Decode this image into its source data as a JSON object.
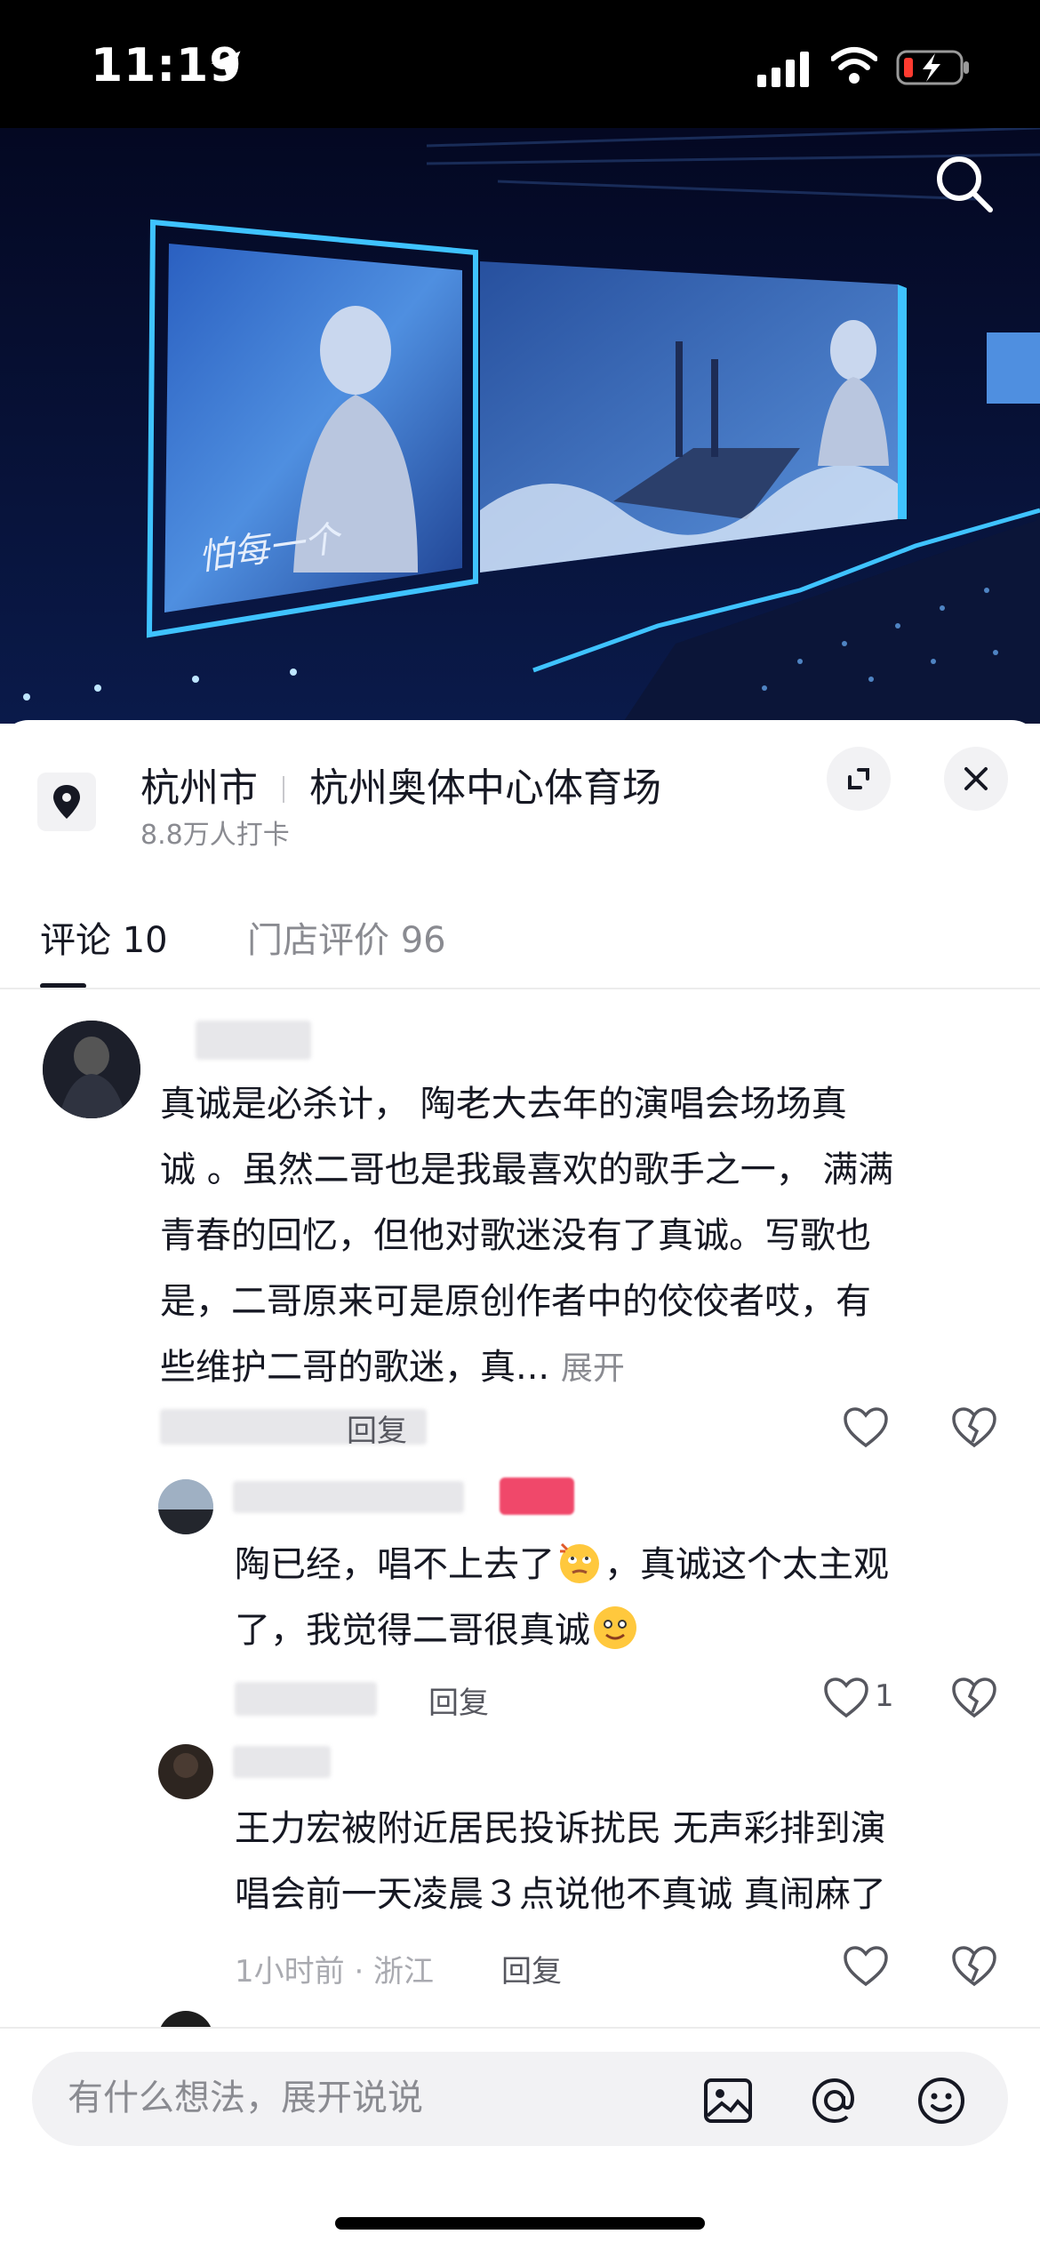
{
  "status_bar": {
    "time": "11:19"
  },
  "location": {
    "city": "杭州市",
    "venue": "杭州奥体中心体育场",
    "checkins": "8.8万人打卡"
  },
  "hero_overlay_text": "怕每一个",
  "tabs": [
    {
      "label": "评论 10",
      "active": true
    },
    {
      "label": "门店评价 96",
      "active": false
    }
  ],
  "comments": [
    {
      "text": "真诚是必杀计，陶老大去年的演唱会场场真诚。虽然二哥也是我最喜欢的歌手之一，满满青春的回忆，但他对歌迷没有了真诚。写歌也是，二哥原来可是原创作者中的佼佼者哎，有些维护二哥的歌迷，真...",
      "lines": [
        "真诚是必杀计， 陶老大去年的演唱会场场真",
        "诚 。虽然二哥也是我最喜欢的歌手之一， 满满",
        "青春的回忆，但他对歌迷没有了真诚。写歌也",
        "是，二哥原来可是原创作者中的佼佼者哎，有",
        "些维护二哥的歌迷，真..."
      ],
      "expand_label": "展开",
      "reply_label": "回复"
    },
    {
      "line1_a": "陶已经，唱不上去了",
      "line1_b": "，真诚这个太主观",
      "line2": "了，我觉得二哥很真诚",
      "reply_label": "回复",
      "likes": "1"
    },
    {
      "lines": [
        "王力宏被附近居民投诉扰民 无声彩排到演",
        "唱会前一天凌晨３点说他不真诚 真闹麻了"
      ],
      "meta": "1小时前 · 浙江",
      "reply_label": "回复"
    }
  ],
  "composer": {
    "placeholder": "有什么想法，展开说说"
  },
  "icons": [
    "location-arrow-icon",
    "signal-icon",
    "wifi-icon",
    "battery-icon",
    "search-icon",
    "pin-icon",
    "expand-icon",
    "close-icon",
    "heart-icon",
    "dislike-icon",
    "image-icon",
    "at-icon",
    "emoji-icon"
  ]
}
